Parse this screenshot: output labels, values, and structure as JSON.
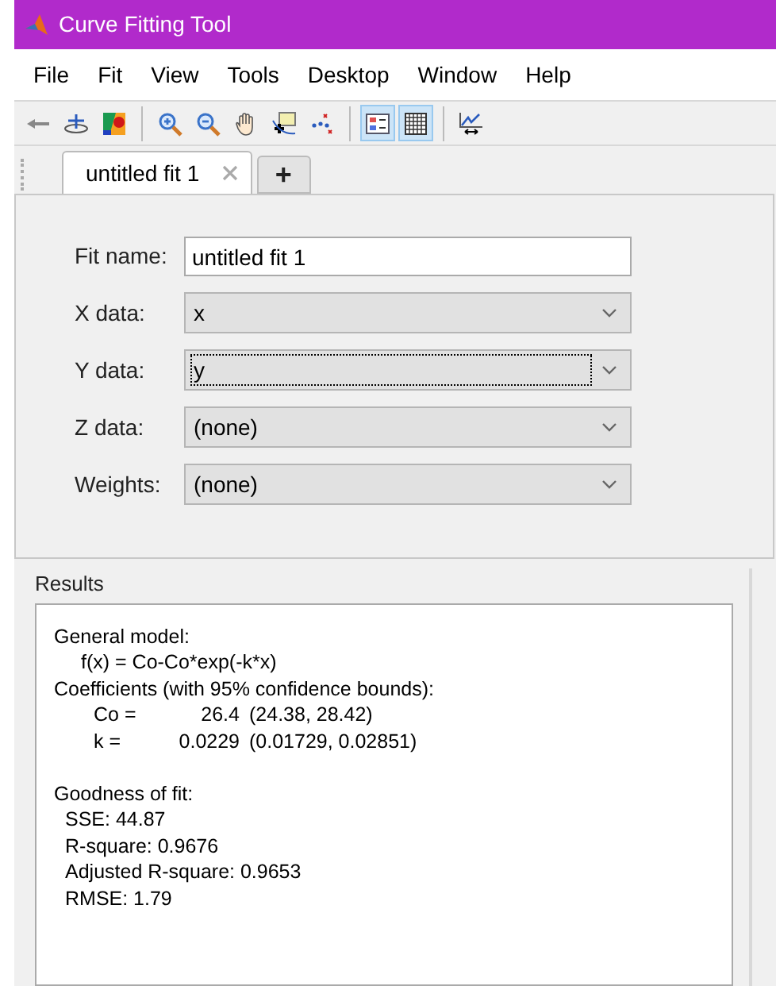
{
  "window": {
    "title": "Curve Fitting Tool"
  },
  "menu": [
    "File",
    "Fit",
    "View",
    "Tools",
    "Desktop",
    "Window",
    "Help"
  ],
  "toolbar": [
    {
      "kind": "arrow",
      "pressed": false
    },
    {
      "kind": "axes",
      "pressed": false
    },
    {
      "kind": "colormap",
      "pressed": false
    },
    {
      "kind": "separator"
    },
    {
      "kind": "zoom-in",
      "pressed": false
    },
    {
      "kind": "zoom-out",
      "pressed": false
    },
    {
      "kind": "hand",
      "pressed": false
    },
    {
      "kind": "cursor",
      "pressed": false
    },
    {
      "kind": "exclude",
      "pressed": false
    },
    {
      "kind": "separator"
    },
    {
      "kind": "legend",
      "pressed": true
    },
    {
      "kind": "grid",
      "pressed": true
    },
    {
      "kind": "separator"
    },
    {
      "kind": "residuals",
      "pressed": false
    }
  ],
  "tabs": [
    {
      "label": "untitled fit 1",
      "selected": true
    }
  ],
  "new_tab": "+",
  "form": [
    {
      "label": "Fit name:",
      "kind": "text",
      "value": "untitled fit 1",
      "focused": false
    },
    {
      "label": "X data:",
      "kind": "select",
      "value": "x",
      "focused": false
    },
    {
      "label": "Y data:",
      "kind": "select",
      "value": "y",
      "focused": true
    },
    {
      "label": "Z data:",
      "kind": "select",
      "value": "(none)",
      "focused": false
    },
    {
      "label": "Weights:",
      "kind": "select",
      "value": "(none)",
      "focused": false
    }
  ],
  "results": {
    "title": "Results",
    "lines": [
      {
        "kind": "heading",
        "text": "General model:"
      },
      {
        "kind": "expression",
        "text": "f(x) = Co-Co*exp(-k*x)"
      },
      {
        "kind": "heading",
        "text": "Coefficients (with 95% confidence bounds):"
      },
      {
        "kind": "coefficient",
        "name": "Co =",
        "value": "26.4",
        "bounds": "(24.38, 28.42)"
      },
      {
        "kind": "coefficient",
        "name": "k =",
        "value": "0.0229",
        "bounds": "(0.01729, 0.02851)"
      },
      {
        "kind": "blank"
      },
      {
        "kind": "heading",
        "text": "Goodness of fit:"
      },
      {
        "kind": "stat",
        "text": "SSE: 44.87"
      },
      {
        "kind": "stat",
        "text": "R-square: 0.9676"
      },
      {
        "kind": "stat",
        "text": "Adjusted R-square: 0.9653"
      },
      {
        "kind": "stat",
        "text": "RMSE: 1.79"
      }
    ]
  }
}
